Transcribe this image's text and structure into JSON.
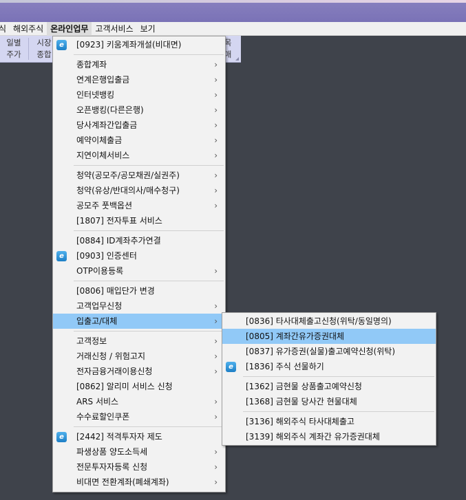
{
  "menubar": {
    "items": [
      "식",
      "해외주식",
      "온라인업무",
      "고객서비스",
      "보기"
    ]
  },
  "toolbar": {
    "b1_l1": "일별",
    "b1_l2": "주가",
    "b2_l1": "시장",
    "b2_l2": "종합",
    "b3_l1": "목",
    "b3_l2": "매"
  },
  "main_menu": {
    "items": [
      {
        "label": "[0923] 키움계좌개설(비대면)",
        "icon": "ie-icon"
      },
      {
        "label": "종합계좌",
        "arrow": "›"
      },
      {
        "label": "연계은행입출금",
        "arrow": "›"
      },
      {
        "label": "인터넷뱅킹",
        "arrow": "›"
      },
      {
        "label": "오픈뱅킹(다른은행)",
        "arrow": "›"
      },
      {
        "label": "당사계좌간입출금",
        "arrow": "›"
      },
      {
        "label": "예약이체출금",
        "arrow": "›"
      },
      {
        "label": "지연이체서비스",
        "arrow": "›"
      },
      {
        "label": "청약(공모주/공모채권/실권주)",
        "arrow": "›"
      },
      {
        "label": "청약(유상/반대의사/매수청구)",
        "arrow": "›"
      },
      {
        "label": "공모주 풋백옵션",
        "arrow": "›"
      },
      {
        "label": "[1807] 전자투표 서비스"
      },
      {
        "label": "[0884] ID계좌추가연결"
      },
      {
        "label": "[0903] 인증센터",
        "icon": "ie-icon"
      },
      {
        "label": "OTP이용등록",
        "arrow": "›"
      },
      {
        "label": "[0806] 매입단가 변경"
      },
      {
        "label": "고객업무신청",
        "arrow": "›"
      },
      {
        "label": "입출고/대체",
        "arrow": "›"
      },
      {
        "label": "고객정보",
        "arrow": "›"
      },
      {
        "label": "거래신청 / 위험고지",
        "arrow": "›"
      },
      {
        "label": "전자금융거래이용신청",
        "arrow": "›"
      },
      {
        "label": "[0862] 알리미 서비스 신청"
      },
      {
        "label": "ARS 서비스",
        "arrow": "›"
      },
      {
        "label": "수수료할인쿠폰",
        "arrow": "›"
      },
      {
        "label": "[2442] 적격투자자 제도",
        "icon": "ie-icon"
      },
      {
        "label": "파생상품 양도소득세",
        "arrow": "›"
      },
      {
        "label": "전문투자자등록 신청",
        "arrow": "›"
      },
      {
        "label": "비대면 전환계좌(폐쇄계좌)",
        "arrow": "›"
      }
    ],
    "selected_label": "입출고/대체"
  },
  "sub_menu": {
    "items": [
      {
        "label": "[0836] 타사대체출고신청(위탁/동일명의)"
      },
      {
        "label": "[0805] 계좌간유가증권대체"
      },
      {
        "label": "[0837] 유가증권(실물)출고예약신청(위탁)"
      },
      {
        "label": "[1836] 주식 선물하기",
        "icon": "ie-icon"
      },
      {
        "label": "[1362] 금현물 상품출고예약신청"
      },
      {
        "label": "[1368] 금현물 당사간 현물대체"
      },
      {
        "label": "[3136] 해외주식 타사대체출고"
      },
      {
        "label": "[3139] 해외주식 계좌간 유가증권대체"
      }
    ],
    "selected_label": "[0805] 계좌간유가증권대체"
  },
  "icon_glyph": "e",
  "colors": {
    "title_bar": "#7a72b6",
    "toolbar": "#d4d6f1",
    "background": "#3f434b",
    "menu_bg": "#f2f2f2",
    "selection": "#91c9f7"
  }
}
